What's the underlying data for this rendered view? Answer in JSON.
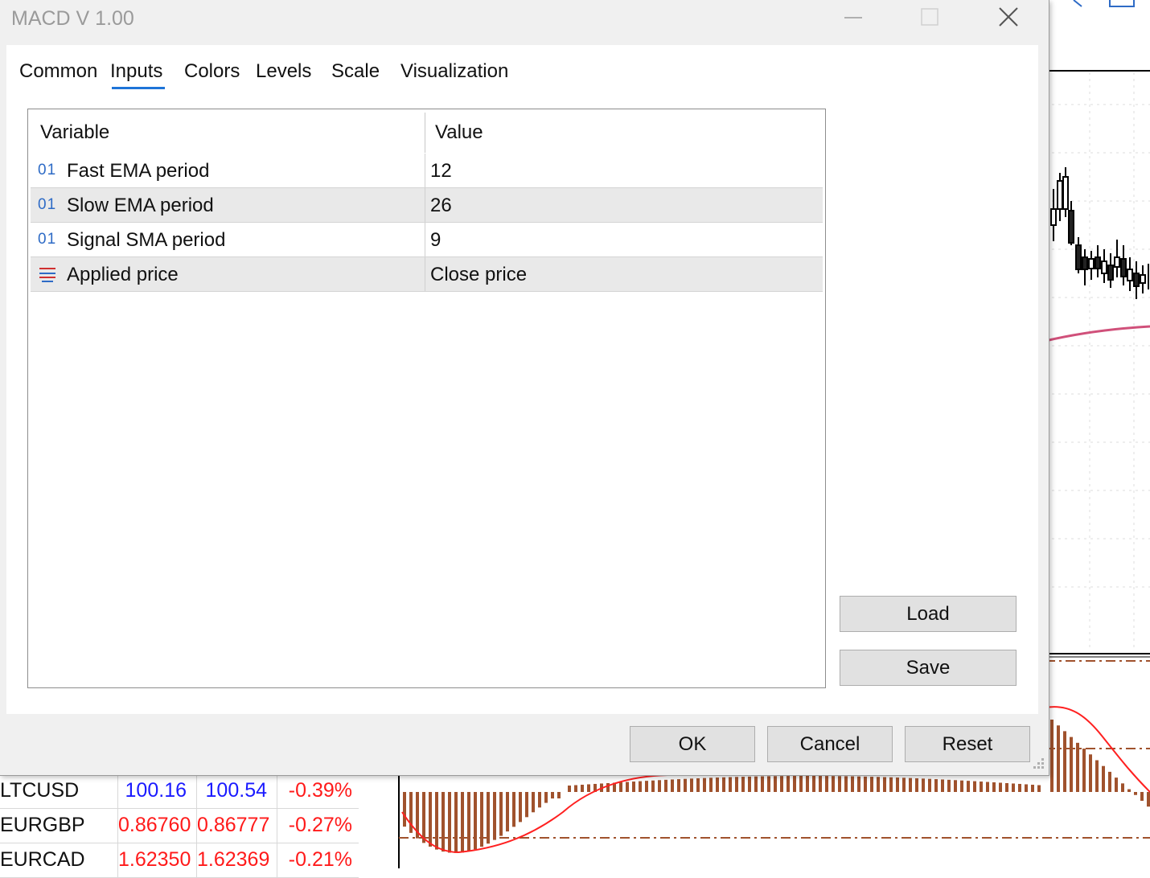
{
  "dialog": {
    "title": "MACD V 1.00",
    "tabs": [
      "Common",
      "Inputs",
      "Colors",
      "Levels",
      "Scale",
      "Visualization"
    ],
    "active_tab": "Inputs",
    "grid": {
      "headers": {
        "variable": "Variable",
        "value": "Value"
      },
      "rows": [
        {
          "icon": "integer-icon",
          "icon_text": "01",
          "variable": "Fast EMA period",
          "value": "12"
        },
        {
          "icon": "integer-icon",
          "icon_text": "01",
          "variable": "Slow EMA period",
          "value": "26"
        },
        {
          "icon": "integer-icon",
          "icon_text": "01",
          "variable": "Signal SMA period",
          "value": "9"
        },
        {
          "icon": "enum-list-icon",
          "icon_text": "",
          "variable": "Applied price",
          "value": "Close price"
        }
      ]
    },
    "side_buttons": {
      "load": "Load",
      "save": "Save"
    },
    "footer_buttons": {
      "ok": "OK",
      "cancel": "Cancel",
      "reset": "Reset"
    }
  },
  "market_watch": {
    "rows": [
      {
        "symbol": "LTCUSD",
        "bid": "100.16",
        "ask": "100.54",
        "change": "-0.39%",
        "color": "#1a1aff"
      },
      {
        "symbol": "EURGBP",
        "bid": "0.86760",
        "ask": "0.86777",
        "change": "-0.27%",
        "color": "#ff1a1a"
      },
      {
        "symbol": "EURCAD",
        "bid": "1.62350",
        "ask": "1.62369",
        "change": "-0.21%",
        "color": "#ff1a1a"
      }
    ],
    "change_color": "#ff1a1a"
  },
  "colors": {
    "accent": "#1e74d8",
    "histogram": "#a0522d",
    "signal_line": "#ff2020",
    "moving_average": "#d0507a"
  }
}
